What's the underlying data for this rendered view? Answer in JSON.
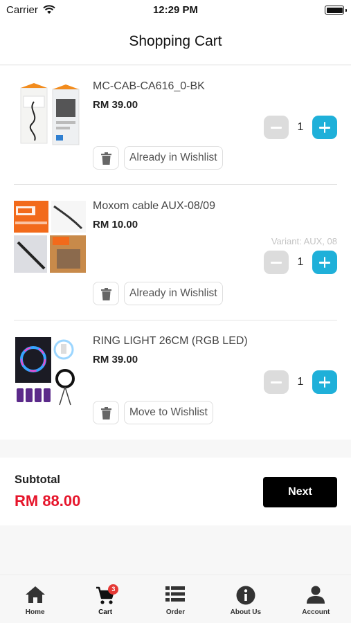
{
  "status_bar": {
    "carrier": "Carrier",
    "time": "12:29 PM"
  },
  "header": {
    "title": "Shopping Cart"
  },
  "cart": {
    "items": [
      {
        "name": "MC-CAB-CA616_0-BK",
        "price": "RM 39.00",
        "variant": "",
        "quantity": "1",
        "wishlist_label": "Already in Wishlist"
      },
      {
        "name": "Moxom cable AUX-08/09",
        "price": "RM 10.00",
        "variant": "Variant: AUX, 08",
        "quantity": "1",
        "wishlist_label": "Already in Wishlist"
      },
      {
        "name": "RING LIGHT 26CM (RGB LED)",
        "price": "RM 39.00",
        "variant": "",
        "quantity": "1",
        "wishlist_label": "Move to Wishlist"
      }
    ]
  },
  "summary": {
    "subtotal_label": "Subtotal",
    "subtotal_value": "RM 88.00",
    "next_label": "Next"
  },
  "tab_bar": {
    "tabs": [
      {
        "label": "Home",
        "icon": "home-icon"
      },
      {
        "label": "Cart",
        "icon": "cart-icon",
        "badge": "3"
      },
      {
        "label": "Order",
        "icon": "list-icon"
      },
      {
        "label": "About Us",
        "icon": "info-icon"
      },
      {
        "label": "Account",
        "icon": "person-icon"
      }
    ],
    "active": "Cart"
  },
  "colors": {
    "accent": "#1fb0d9",
    "price_red": "#e6152b",
    "primary_button": "#000000"
  }
}
